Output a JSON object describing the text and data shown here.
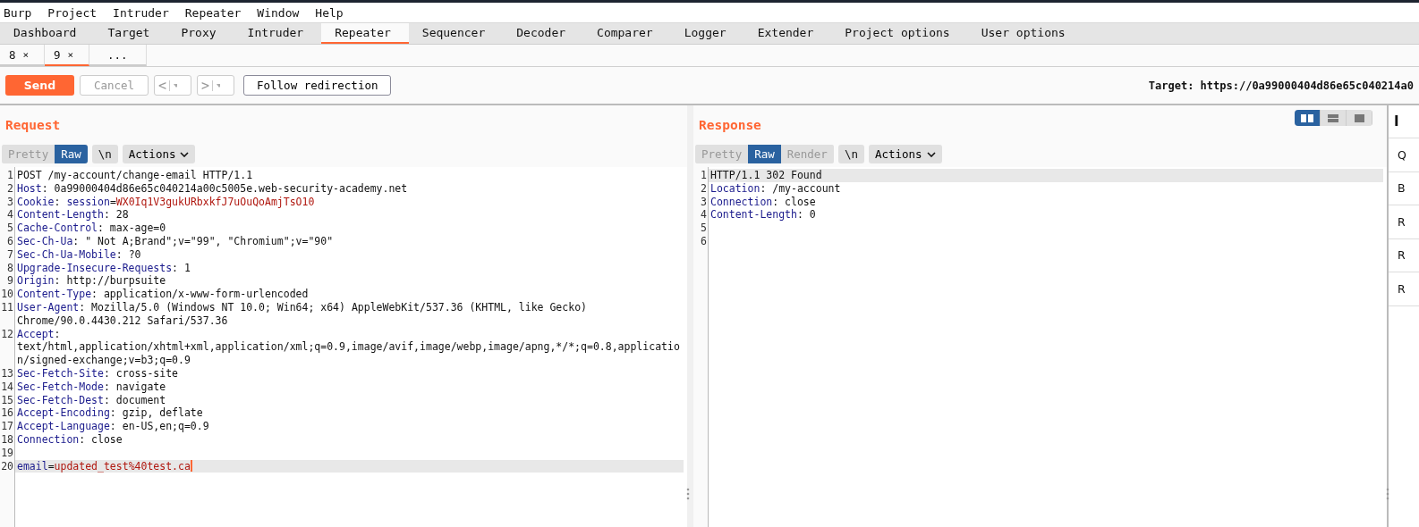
{
  "menu": [
    "Burp",
    "Project",
    "Intruder",
    "Repeater",
    "Window",
    "Help"
  ],
  "tabs": [
    {
      "label": "Dashboard",
      "selected": false
    },
    {
      "label": "Target",
      "selected": false
    },
    {
      "label": "Proxy",
      "selected": false
    },
    {
      "label": "Intruder",
      "selected": false
    },
    {
      "label": "Repeater",
      "selected": true
    },
    {
      "label": "Sequencer",
      "selected": false
    },
    {
      "label": "Decoder",
      "selected": false
    },
    {
      "label": "Comparer",
      "selected": false
    },
    {
      "label": "Logger",
      "selected": false
    },
    {
      "label": "Extender",
      "selected": false
    },
    {
      "label": "Project options",
      "selected": false
    },
    {
      "label": "User options",
      "selected": false
    }
  ],
  "subtabs": [
    {
      "label": "8",
      "close": "×",
      "selected": false
    },
    {
      "label": "9",
      "close": "×",
      "selected": true
    },
    {
      "label": "...",
      "selected": false
    }
  ],
  "toolbar": {
    "send": "Send",
    "cancel": "Cancel",
    "cancel_disabled": true,
    "back": "<",
    "forward": ">",
    "follow": "Follow redirection",
    "target": "Target: https://0a99000404d86e65c040214a0"
  },
  "layout_buttons": [
    {
      "kind": "columns",
      "selected": true
    },
    {
      "kind": "rows",
      "selected": false
    },
    {
      "kind": "single",
      "selected": false
    }
  ],
  "request": {
    "title": "Request",
    "views": [
      {
        "label": "Pretty",
        "selected": false,
        "disabled": true
      },
      {
        "label": "Raw",
        "selected": true,
        "disabled": false
      },
      {
        "label": "\\n",
        "selected": false,
        "disabled": false
      }
    ],
    "actions": "Actions",
    "lines": [
      {
        "number": "1",
        "highlighted": false,
        "rows": [
          [
            {
              "kind": "plain",
              "text": "POST /my-account/change-email HTTP/1.1"
            }
          ]
        ]
      },
      {
        "number": "2",
        "highlighted": false,
        "rows": [
          [
            {
              "kind": "key",
              "text": "Host"
            },
            {
              "kind": "plain",
              "text": ": 0a99000404d86e65c040214a00c5005e.web-security-academy.net"
            }
          ]
        ]
      },
      {
        "number": "3",
        "highlighted": false,
        "rows": [
          [
            {
              "kind": "key",
              "text": "Cookie"
            },
            {
              "kind": "plain",
              "text": ": "
            },
            {
              "kind": "key",
              "text": "session"
            },
            {
              "kind": "plain",
              "text": "="
            },
            {
              "kind": "value",
              "text": "WX0Iq1V3gukURbxkfJ7uOuQoAmjTsO10"
            }
          ]
        ]
      },
      {
        "number": "4",
        "highlighted": false,
        "rows": [
          [
            {
              "kind": "key",
              "text": "Content-Length"
            },
            {
              "kind": "plain",
              "text": ": 28"
            }
          ]
        ]
      },
      {
        "number": "5",
        "highlighted": false,
        "rows": [
          [
            {
              "kind": "key",
              "text": "Cache-Control"
            },
            {
              "kind": "plain",
              "text": ": max-age=0"
            }
          ]
        ]
      },
      {
        "number": "6",
        "highlighted": false,
        "rows": [
          [
            {
              "kind": "key",
              "text": "Sec-Ch-Ua"
            },
            {
              "kind": "plain",
              "text": ": \" Not A;Brand\";v=\"99\", \"Chromium\";v=\"90\""
            }
          ]
        ]
      },
      {
        "number": "7",
        "highlighted": false,
        "rows": [
          [
            {
              "kind": "key",
              "text": "Sec-Ch-Ua-Mobile"
            },
            {
              "kind": "plain",
              "text": ": ?0"
            }
          ]
        ]
      },
      {
        "number": "8",
        "highlighted": false,
        "rows": [
          [
            {
              "kind": "key",
              "text": "Upgrade-Insecure-Requests"
            },
            {
              "kind": "plain",
              "text": ": 1"
            }
          ]
        ]
      },
      {
        "number": "9",
        "highlighted": false,
        "rows": [
          [
            {
              "kind": "key",
              "text": "Origin"
            },
            {
              "kind": "plain",
              "text": ": http://burpsuite"
            }
          ]
        ]
      },
      {
        "number": "10",
        "highlighted": false,
        "rows": [
          [
            {
              "kind": "key",
              "text": "Content-Type"
            },
            {
              "kind": "plain",
              "text": ": application/x-www-form-urlencoded"
            }
          ]
        ]
      },
      {
        "number": "11",
        "highlighted": false,
        "rows": [
          [
            {
              "kind": "key",
              "text": "User-Agent"
            },
            {
              "kind": "plain",
              "text": ": Mozilla/5.0 (Windows NT 10.0; Win64; x64) AppleWebKit/537.36 (KHTML, like Gecko)"
            }
          ],
          [
            {
              "kind": "plain",
              "text": "Chrome/90.0.4430.212 Safari/537.36"
            }
          ]
        ]
      },
      {
        "number": "12",
        "highlighted": false,
        "rows": [
          [
            {
              "kind": "key",
              "text": "Accept"
            },
            {
              "kind": "plain",
              "text": ":"
            }
          ],
          [
            {
              "kind": "plain",
              "text": "text/html,application/xhtml+xml,application/xml;q=0.9,image/avif,image/webp,image/apng,*/*;q=0.8,applicatio"
            }
          ],
          [
            {
              "kind": "plain",
              "text": "n/signed-exchange;v=b3;q=0.9"
            }
          ]
        ]
      },
      {
        "number": "13",
        "highlighted": false,
        "rows": [
          [
            {
              "kind": "key",
              "text": "Sec-Fetch-Site"
            },
            {
              "kind": "plain",
              "text": ": cross-site"
            }
          ]
        ]
      },
      {
        "number": "14",
        "highlighted": false,
        "rows": [
          [
            {
              "kind": "key",
              "text": "Sec-Fetch-Mode"
            },
            {
              "kind": "plain",
              "text": ": navigate"
            }
          ]
        ]
      },
      {
        "number": "15",
        "highlighted": false,
        "rows": [
          [
            {
              "kind": "key",
              "text": "Sec-Fetch-Dest"
            },
            {
              "kind": "plain",
              "text": ": document"
            }
          ]
        ]
      },
      {
        "number": "16",
        "highlighted": false,
        "rows": [
          [
            {
              "kind": "key",
              "text": "Accept-Encoding"
            },
            {
              "kind": "plain",
              "text": ": gzip, deflate"
            }
          ]
        ]
      },
      {
        "number": "17",
        "highlighted": false,
        "rows": [
          [
            {
              "kind": "key",
              "text": "Accept-Language"
            },
            {
              "kind": "plain",
              "text": ": en-US,en;q=0.9"
            }
          ]
        ]
      },
      {
        "number": "18",
        "highlighted": false,
        "rows": [
          [
            {
              "kind": "key",
              "text": "Connection"
            },
            {
              "kind": "plain",
              "text": ": close"
            }
          ]
        ]
      },
      {
        "number": "19",
        "highlighted": false,
        "rows": [
          []
        ]
      },
      {
        "number": "20",
        "highlighted": true,
        "cursor": true,
        "rows": [
          [
            {
              "kind": "key",
              "text": "email"
            },
            {
              "kind": "plain",
              "text": "="
            },
            {
              "kind": "value",
              "text": "updated_test%40test.ca"
            }
          ]
        ]
      }
    ]
  },
  "response": {
    "title": "Response",
    "views": [
      {
        "label": "Pretty",
        "selected": false,
        "disabled": true
      },
      {
        "label": "Raw",
        "selected": true,
        "disabled": false
      },
      {
        "label": "Render",
        "selected": false,
        "disabled": true
      },
      {
        "label": "\\n",
        "selected": false,
        "disabled": false
      }
    ],
    "actions": "Actions",
    "lines": [
      {
        "number": "1",
        "highlighted": true,
        "rows": [
          [
            {
              "kind": "plain",
              "text": "HTTP/1.1 302 Found"
            }
          ]
        ]
      },
      {
        "number": "2",
        "highlighted": false,
        "rows": [
          [
            {
              "kind": "key",
              "text": "Location"
            },
            {
              "kind": "plain",
              "text": ": /my-account"
            }
          ]
        ]
      },
      {
        "number": "3",
        "highlighted": false,
        "rows": [
          [
            {
              "kind": "key",
              "text": "Connection"
            },
            {
              "kind": "plain",
              "text": ": close"
            }
          ]
        ]
      },
      {
        "number": "4",
        "highlighted": false,
        "rows": [
          [
            {
              "kind": "key",
              "text": "Content-Length"
            },
            {
              "kind": "plain",
              "text": ": 0"
            }
          ]
        ]
      },
      {
        "number": "5",
        "highlighted": false,
        "rows": [
          []
        ]
      },
      {
        "number": "6",
        "highlighted": false,
        "rows": [
          []
        ]
      }
    ]
  },
  "inspector": {
    "title": "I",
    "items": [
      "Q",
      "B",
      "R",
      "R",
      "R"
    ]
  }
}
